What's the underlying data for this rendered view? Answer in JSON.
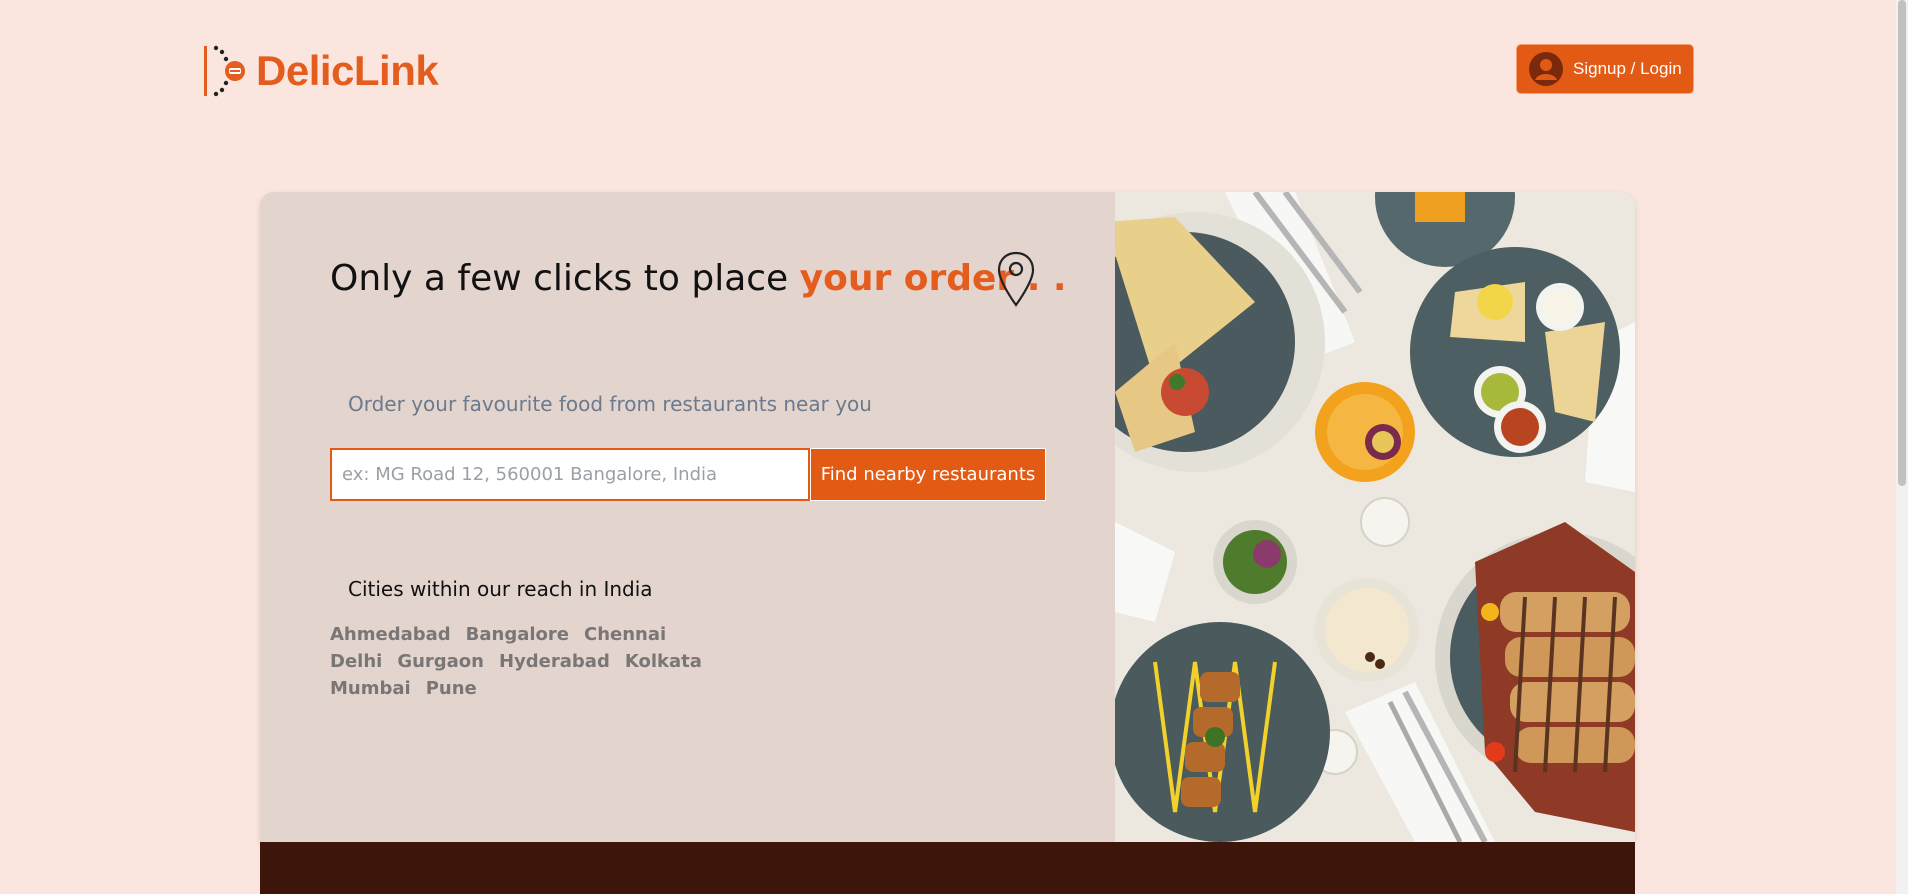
{
  "brand": {
    "name": "DelicLink"
  },
  "header": {
    "login_label": "Signup / Login"
  },
  "hero": {
    "headline_prefix": "Only a few clicks to place ",
    "headline_accent": "your order . .",
    "subtitle": "Order your favourite food from restaurants near you",
    "search": {
      "placeholder": "ex: MG Road 12, 560001 Bangalore, India",
      "value": "",
      "button_label": "Find nearby restaurants"
    },
    "cities_title": "Cities within our reach in India",
    "cities": [
      "Ahmedabad",
      "Bangalore",
      "Chennai",
      "Delhi",
      "Gurgaon",
      "Hyderabad",
      "Kolkata",
      "Mumbai",
      "Pune"
    ]
  },
  "colors": {
    "page_bg": "#fae6de",
    "accent": "#e35a14",
    "card_bg": "#e3d4cd",
    "footer": "#3d150b"
  },
  "icons": [
    "logo-mark-icon",
    "user-avatar-icon",
    "location-pin-icon"
  ]
}
